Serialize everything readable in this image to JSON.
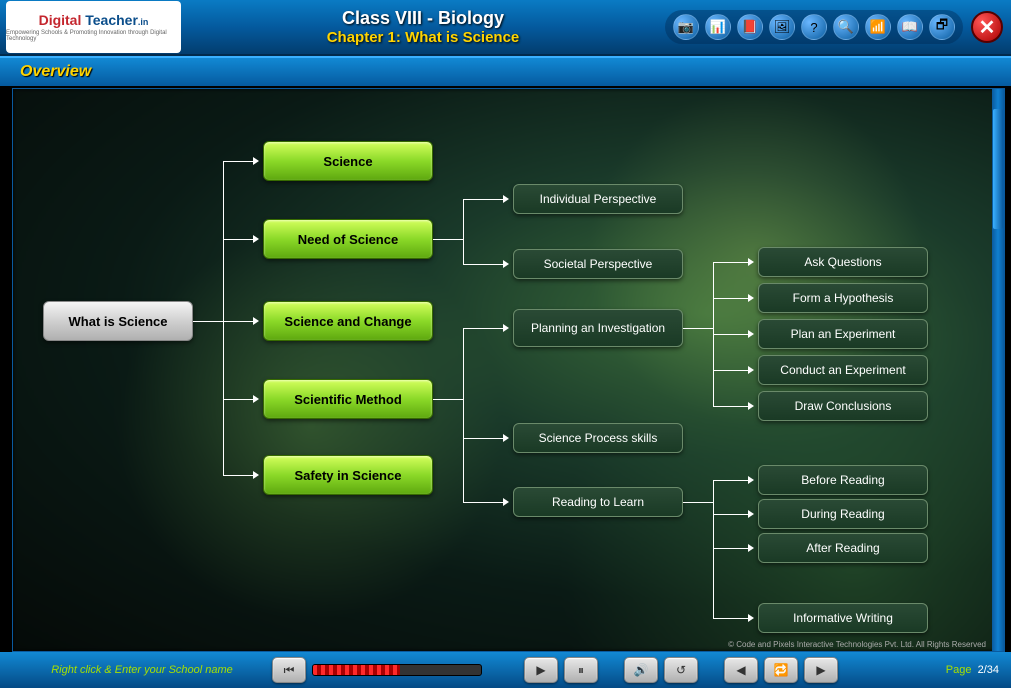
{
  "header": {
    "logo": {
      "text_a": "Digital",
      "text_b": " Teacher",
      "suffix": ".in",
      "tagline": "Empowering Schools & Promoting Innovation through Digital Technology"
    },
    "title": "Class VIII - Biology",
    "subtitle": "Chapter 1: What is Science",
    "tools": [
      "📷",
      "📊",
      "📕",
      "🖼",
      "?",
      "🔍",
      "📶",
      "📖",
      "🗗"
    ]
  },
  "subheader": {
    "title": "Overview"
  },
  "diagram": {
    "root": "What is Science",
    "mains": [
      "Science",
      "Need of Science",
      "Science and Change",
      "Scientific Method",
      "Safety in Science"
    ],
    "need_children": [
      "Individual Perspective",
      "Societal Perspective"
    ],
    "method_children": [
      "Planning an Investigation",
      "Science Process skills",
      "Reading to Learn"
    ],
    "planning_children": [
      "Ask Questions",
      "Form a Hypothesis",
      "Plan an Experiment",
      "Conduct an Experiment",
      "Draw Conclusions"
    ],
    "reading_children": [
      "Before Reading",
      "During Reading",
      "After Reading"
    ],
    "extra": "Informative Writing"
  },
  "footer": {
    "school_prompt": "Right click & Enter your School name",
    "page_label": "Page",
    "page_current": "2/34",
    "copyright": "© Code and Pixels Interactive Technologies  Pvt. Ltd. All Rights Reserved"
  }
}
